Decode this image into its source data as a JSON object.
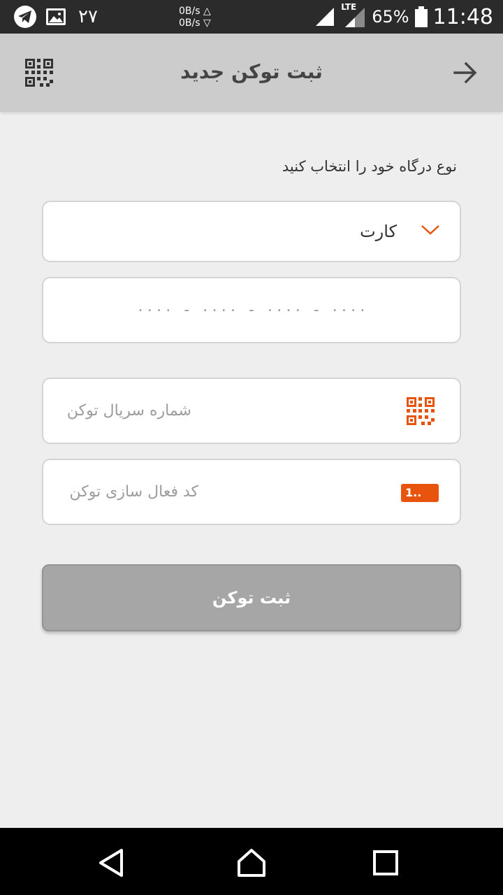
{
  "status_bar": {
    "date": "۲۷",
    "net_up": "0B/s △",
    "net_down": "0B/s ▽",
    "network_type": "LTE",
    "battery": "65%",
    "time": "11:48"
  },
  "header": {
    "title": "ثبت توکن جدید"
  },
  "form": {
    "gateway_label": "نوع درگاه خود را انتخاب کنید",
    "gateway_selected": "کارت",
    "card_placeholder": "۰۰۰۰ - ۰۰۰۰ - ۰۰۰۰ - ۰۰۰۰",
    "serial_placeholder": "شماره سریال توکن",
    "activation_placeholder": "کد فعال سازی توکن",
    "activation_icon_text": "1..",
    "submit_label": "ثبت توکن"
  },
  "colors": {
    "accent": "#e8540d",
    "header_bg": "#cccccc",
    "button_disabled": "#a6a6a6",
    "page_bg": "#eeeeee"
  },
  "icons": {
    "status_left": [
      "telegram-icon",
      "image-icon"
    ],
    "header_left": "qr-code-icon",
    "header_right": "arrow-right-icon",
    "select": "chevron-down-icon",
    "serial": "qr-code-icon",
    "activation": "token-device-icon",
    "nav": [
      "back-triangle-icon",
      "home-icon",
      "recent-apps-icon"
    ]
  }
}
